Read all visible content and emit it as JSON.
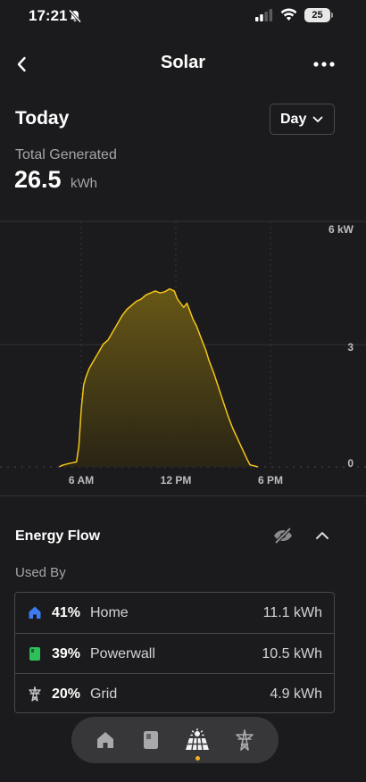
{
  "status": {
    "time": "17:21",
    "battery": "25"
  },
  "header": {
    "title": "Solar"
  },
  "period": {
    "title": "Today",
    "selected": "Day"
  },
  "total": {
    "label": "Total Generated",
    "value": "26.5",
    "unit": "kWh"
  },
  "chart_data": {
    "type": "area",
    "x_ticks": [
      "6 AM",
      "12 PM",
      "6 PM"
    ],
    "y_ticks": [
      "6 kW",
      "3",
      "0"
    ],
    "ylim": [
      0,
      6
    ],
    "x_unit": "hour",
    "x": [
      4.6,
      4.8,
      5.2,
      5.7,
      5.85,
      6.0,
      6.15,
      6.3,
      6.5,
      6.8,
      7.1,
      7.4,
      7.7,
      8.0,
      8.3,
      8.6,
      8.9,
      9.2,
      9.5,
      9.8,
      10.1,
      10.4,
      10.7,
      11.0,
      11.3,
      11.6,
      11.9,
      12.1,
      12.3,
      12.5,
      12.7,
      12.9,
      13.1,
      13.3,
      13.5,
      13.7,
      13.9,
      14.1,
      14.4,
      14.7,
      15.0,
      15.3,
      15.6,
      15.9,
      16.2,
      16.5,
      16.7,
      17.2
    ],
    "values": [
      0,
      0.04,
      0.08,
      0.12,
      0.5,
      1.4,
      2.0,
      2.2,
      2.4,
      2.6,
      2.8,
      3.0,
      3.1,
      3.3,
      3.5,
      3.7,
      3.85,
      3.95,
      4.05,
      4.1,
      4.2,
      4.25,
      4.3,
      4.25,
      4.28,
      4.35,
      4.3,
      4.1,
      4.0,
      3.9,
      4.0,
      3.8,
      3.6,
      3.45,
      3.25,
      3.05,
      2.85,
      2.6,
      2.3,
      1.95,
      1.6,
      1.25,
      0.95,
      0.7,
      0.45,
      0.2,
      0.05,
      0
    ],
    "grid": true,
    "color": "#f5c518"
  },
  "energy_flow": {
    "title": "Energy Flow",
    "used_by_label": "Used By",
    "rows": [
      {
        "percent": "41%",
        "name": "Home",
        "value": "11.1 kWh",
        "icon": "home-icon",
        "icon_color": "#3e7bf0"
      },
      {
        "percent": "39%",
        "name": "Powerwall",
        "value": "10.5 kWh",
        "icon": "powerwall-icon",
        "icon_color": "#2fbf5a"
      },
      {
        "percent": "20%",
        "name": "Grid",
        "value": "4.9 kWh",
        "icon": "grid-tower-icon",
        "icon_color": "#c8c8c8"
      }
    ]
  },
  "tabs": [
    {
      "name": "Home",
      "icon": "home-icon",
      "active": false
    },
    {
      "name": "Powerwall",
      "icon": "powerwall-icon",
      "active": false
    },
    {
      "name": "Solar",
      "icon": "solar-icon",
      "active": true
    },
    {
      "name": "Grid",
      "icon": "grid-tower-icon",
      "active": false
    }
  ],
  "accent": "#f2b01e"
}
